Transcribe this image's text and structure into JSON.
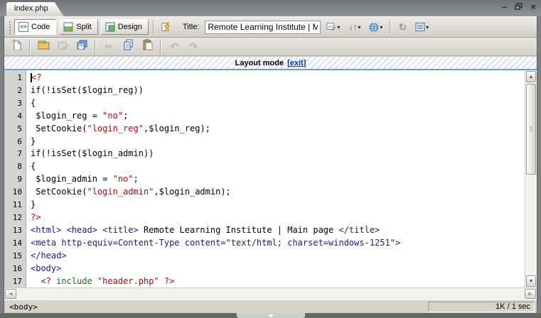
{
  "window": {
    "tab_title": "index.php"
  },
  "icons": {
    "chevron_down": "▾",
    "minimize": "–",
    "close": "×",
    "code_glyph": "<>",
    "arrow_down": "↓",
    "arrow_up": "↑",
    "check": "✓",
    "refresh": "↻",
    "cut": "✂",
    "undo": "↶",
    "redo": "↷",
    "scroll_up": "▲",
    "scroll_down": "▼",
    "scroll_left": "◀",
    "scroll_right": "▶"
  },
  "toolbar": {
    "code_label": "Code",
    "split_label": "Split",
    "design_label": "Design",
    "title_label": "Title:",
    "title_value": "Remote Learning Institute | Main page"
  },
  "layout_bar": {
    "text": "Layout mode",
    "exit_link": "[exit]"
  },
  "code": {
    "lines": [
      {
        "n": 1,
        "caret": true,
        "tokens": [
          [
            "php",
            "<?"
          ]
        ]
      },
      {
        "n": 2,
        "tokens": [
          [
            "plain",
            "if(!isSet($login_reg))"
          ]
        ]
      },
      {
        "n": 3,
        "tokens": [
          [
            "plain",
            "{"
          ]
        ]
      },
      {
        "n": 4,
        "tokens": [
          [
            "plain",
            " $login_reg = "
          ],
          [
            "str",
            "\"no\""
          ],
          [
            "plain",
            ";"
          ]
        ]
      },
      {
        "n": 5,
        "tokens": [
          [
            "plain",
            " SetCookie("
          ],
          [
            "str",
            "\"login_reg\""
          ],
          [
            "plain",
            ",$login_reg);"
          ]
        ]
      },
      {
        "n": 6,
        "tokens": [
          [
            "plain",
            "}"
          ]
        ]
      },
      {
        "n": 7,
        "tokens": [
          [
            "plain",
            "if(!isSet($login_admin))"
          ]
        ]
      },
      {
        "n": 8,
        "tokens": [
          [
            "plain",
            "{"
          ]
        ]
      },
      {
        "n": 9,
        "tokens": [
          [
            "plain",
            " $login_admin = "
          ],
          [
            "str",
            "\"no\""
          ],
          [
            "plain",
            ";"
          ]
        ]
      },
      {
        "n": 10,
        "tokens": [
          [
            "plain",
            " SetCookie("
          ],
          [
            "str",
            "\"login_admin\""
          ],
          [
            "plain",
            ",$login_admin);"
          ]
        ]
      },
      {
        "n": 11,
        "tokens": [
          [
            "plain",
            "}"
          ]
        ]
      },
      {
        "n": 12,
        "tokens": [
          [
            "php",
            "?>"
          ]
        ]
      },
      {
        "n": 13,
        "tokens": [
          [
            "tag",
            "<html> <head> <title>"
          ],
          [
            "plain",
            " Remote Learning Institute | Main page "
          ],
          [
            "tag",
            "</title>"
          ]
        ]
      },
      {
        "n": 14,
        "tokens": [
          [
            "tag",
            "<meta http-equiv=Content-Type content=\"text/html; charset=windows-1251\">"
          ]
        ]
      },
      {
        "n": 15,
        "tokens": [
          [
            "tag",
            "</head>"
          ]
        ]
      },
      {
        "n": 16,
        "tokens": [
          [
            "tag",
            "<body>"
          ]
        ]
      },
      {
        "n": 17,
        "tokens": [
          [
            "plain",
            "  "
          ],
          [
            "php",
            "<?"
          ],
          [
            "plain",
            " "
          ],
          [
            "kw",
            "include"
          ],
          [
            "plain",
            " "
          ],
          [
            "str",
            "\"header.php\""
          ],
          [
            "plain",
            " "
          ],
          [
            "php",
            "?>"
          ]
        ]
      }
    ]
  },
  "status_bar": {
    "tag_selector": "<body>",
    "doc_size": "1K / 1 sec"
  }
}
